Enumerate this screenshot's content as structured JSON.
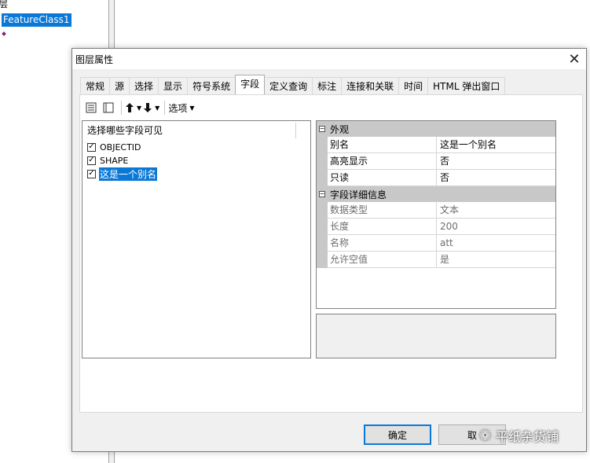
{
  "background": {
    "layer_label": "层",
    "feature_class": "FeatureClass1"
  },
  "dialog": {
    "title": "图层属性",
    "close_glyph": "✕",
    "tabs": [
      "常规",
      "源",
      "选择",
      "显示",
      "符号系统",
      "字段",
      "定义查询",
      "标注",
      "连接和关联",
      "时间",
      "HTML 弹出窗口"
    ],
    "active_tab": "字段",
    "toolbar": {
      "options_label": "选项"
    },
    "fields_panel": {
      "header": "选择哪些字段可见",
      "fields": [
        {
          "name": "OBJECTID",
          "checked": true,
          "selected": false
        },
        {
          "name": "SHAPE",
          "checked": true,
          "selected": false
        },
        {
          "name": "这是一个别名",
          "checked": true,
          "selected": true
        }
      ]
    },
    "property_grid": {
      "categories": [
        {
          "name": "外观",
          "rows": [
            {
              "name": "别名",
              "value": "这是一个别名",
              "readonly": false
            },
            {
              "name": "高亮显示",
              "value": "否",
              "readonly": false
            },
            {
              "name": "只读",
              "value": "否",
              "readonly": false
            }
          ]
        },
        {
          "name": "字段详细信息",
          "rows": [
            {
              "name": "数据类型",
              "value": "文本",
              "readonly": true
            },
            {
              "name": "长度",
              "value": "200",
              "readonly": true
            },
            {
              "name": "名称",
              "value": "att",
              "readonly": true
            },
            {
              "name": "允许空值",
              "value": "是",
              "readonly": true
            }
          ]
        }
      ]
    },
    "buttons": {
      "ok": "确定",
      "cancel": "取"
    }
  },
  "watermark": {
    "text": "平纸杂货铺"
  },
  "colors": {
    "selection": "#0a78d7",
    "category_bg": "#c8c8c8",
    "dialog_bg": "#f0f0f0"
  }
}
